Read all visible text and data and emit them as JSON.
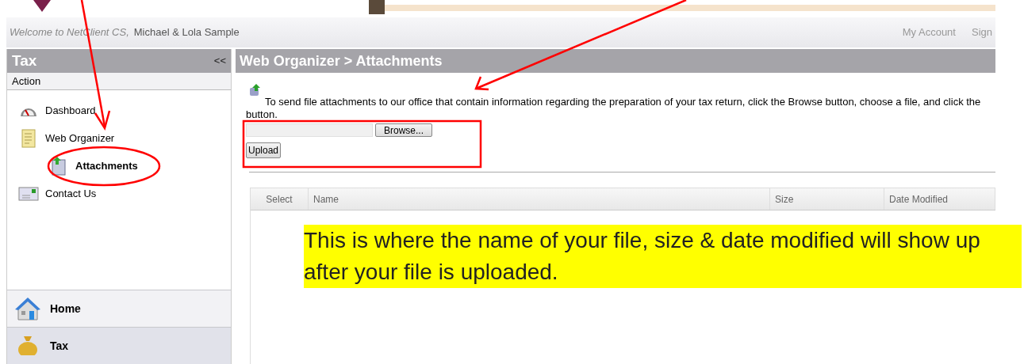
{
  "header": {
    "welcome": "Welcome to NetClient CS,",
    "user": "Michael & Lola Sample",
    "links": [
      "My Account",
      "Sign"
    ]
  },
  "sidebar": {
    "title": "Tax",
    "collapse": "<<",
    "section": "Action",
    "items": [
      {
        "label": "Dashboard",
        "selected": false
      },
      {
        "label": "Web Organizer",
        "selected": false,
        "children": [
          {
            "label": "Attachments",
            "selected": true
          }
        ]
      },
      {
        "label": "Contact Us",
        "selected": false
      }
    ],
    "nav": [
      {
        "label": "Home",
        "selected": false
      },
      {
        "label": "Tax",
        "selected": true
      }
    ]
  },
  "main": {
    "breadcrumb": "Web Organizer > Attachments",
    "instructions": "To send file attachments to our office that contain information regarding the preparation of your tax return, click the Browse button, choose a file, and click the button.",
    "browse": "Browse...",
    "upload": "Upload",
    "table": {
      "columns": [
        "Select",
        "Name",
        "Size",
        "Date Modified"
      ]
    }
  },
  "annotation": {
    "note": "This is where the name of your file, size & date modified will show up after your file is uploaded."
  }
}
